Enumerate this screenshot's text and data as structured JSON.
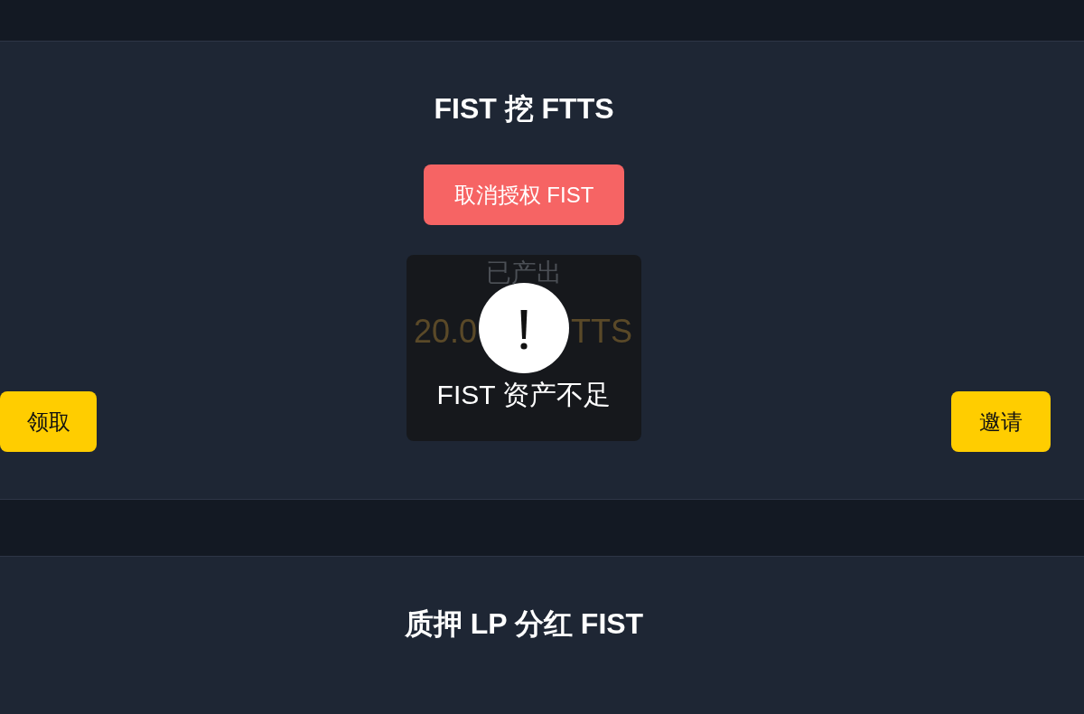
{
  "mining": {
    "title": "FIST 挖 FTTS",
    "revoke_button": "取消授权 FIST",
    "produced": {
      "label": "已产出",
      "amount_parts": [
        "20.0",
        "TTS"
      ]
    },
    "claim_button": "领取",
    "invite_button": "邀请"
  },
  "toast": {
    "kind": "warning",
    "message": "FIST 资产不足"
  },
  "staking": {
    "title": "质押 LP 分红 FIST"
  }
}
